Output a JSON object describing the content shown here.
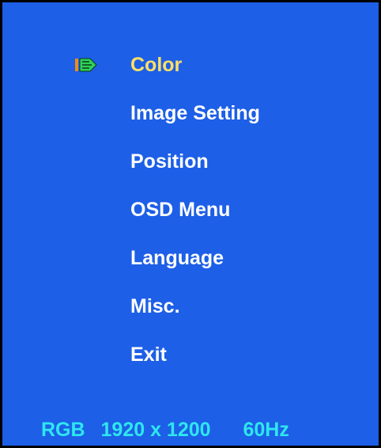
{
  "menu": {
    "items": [
      {
        "label": "Color",
        "selected": true
      },
      {
        "label": "Image Setting",
        "selected": false
      },
      {
        "label": "Position",
        "selected": false
      },
      {
        "label": "OSD Menu",
        "selected": false
      },
      {
        "label": "Language",
        "selected": false
      },
      {
        "label": "Misc.",
        "selected": false
      },
      {
        "label": "Exit",
        "selected": false
      }
    ],
    "selector_icon": "selection-arrow-icon"
  },
  "status": {
    "signal": "RGB",
    "resolution": "1920 x 1200",
    "refresh": "60Hz"
  },
  "colors": {
    "background": "#1d5fe6",
    "text": "#ffffff",
    "selected_text": "#ffe066",
    "status_text": "#2ee6f0",
    "border": "#000000",
    "icon_orange": "#f08a1c",
    "icon_green": "#2fd15a"
  }
}
